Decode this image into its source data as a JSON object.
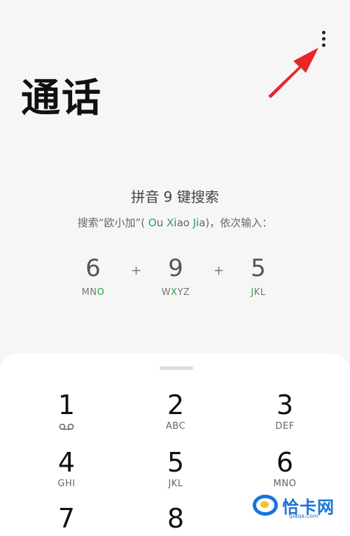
{
  "header": {
    "title": "通话"
  },
  "hint": {
    "title": "拼音 9 键搜索",
    "sub_prefix": "搜索“欧小加”( ",
    "sub_o": "O",
    "sub_u": "u ",
    "sub_x": "X",
    "sub_iao": "iao ",
    "sub_j": "J",
    "sub_ia": "ia",
    "sub_suffix": ")，依次输入："
  },
  "sequence": [
    {
      "num": "6",
      "letters_a": "MN",
      "letters_g": "O",
      "letters_b": ""
    },
    {
      "num": "9",
      "letters_a": "W",
      "letters_g": "X",
      "letters_b": "YZ"
    },
    {
      "num": "5",
      "letters_a": "",
      "letters_g": "J",
      "letters_b": "KL"
    }
  ],
  "plus": "+",
  "keypad": {
    "keys": [
      {
        "num": "1",
        "letters": ""
      },
      {
        "num": "2",
        "letters": "ABC"
      },
      {
        "num": "3",
        "letters": "DEF"
      },
      {
        "num": "4",
        "letters": "GHI"
      },
      {
        "num": "5",
        "letters": "JKL"
      },
      {
        "num": "6",
        "letters": "MNO"
      },
      {
        "num": "7",
        "letters": ""
      },
      {
        "num": "8",
        "letters": ""
      }
    ]
  },
  "watermark": {
    "text": "恰卡网",
    "url": "qiaqa.com"
  },
  "colors": {
    "accent_green": "#23a84a",
    "arrow_red": "#e8262a",
    "logo_blue": "#1a74d9"
  },
  "icons": {
    "more": "vertical-dots",
    "voicemail": "voicemail"
  }
}
